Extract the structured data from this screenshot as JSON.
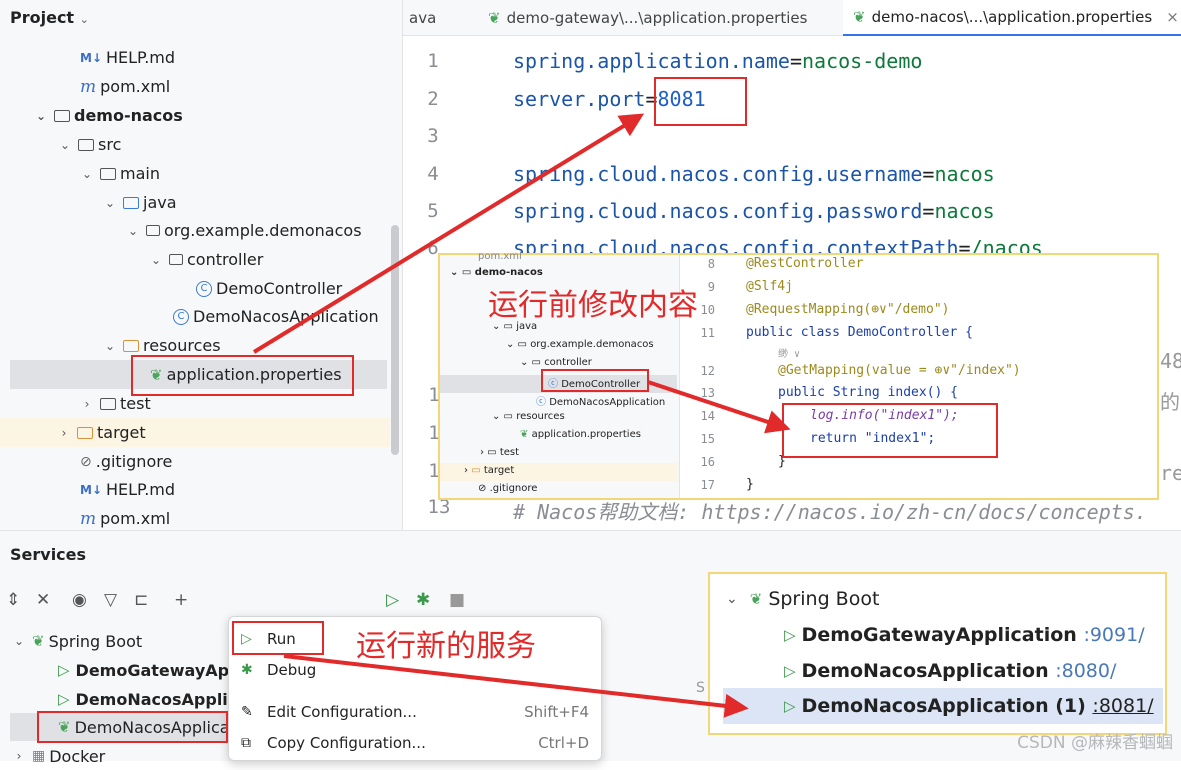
{
  "project": {
    "title": "Project",
    "tree": [
      {
        "label": "HELP.md",
        "icon": "markdown-icon"
      },
      {
        "label": "pom.xml",
        "icon": "maven-icon"
      },
      {
        "label": "demo-nacos",
        "icon": "module-folder-icon"
      },
      {
        "label": "src",
        "icon": "folder-icon"
      },
      {
        "label": "main",
        "icon": "folder-icon"
      },
      {
        "label": "java",
        "icon": "source-folder-icon"
      },
      {
        "label": "org.example.demonacos",
        "icon": "package-icon"
      },
      {
        "label": "controller",
        "icon": "package-icon"
      },
      {
        "label": "DemoController",
        "icon": "class-icon"
      },
      {
        "label": "DemoNacosApplication",
        "icon": "spring-class-icon"
      },
      {
        "label": "resources",
        "icon": "resources-folder-icon"
      },
      {
        "label": "application.properties",
        "icon": "spring-leaf-icon"
      },
      {
        "label": "test",
        "icon": "folder-icon"
      },
      {
        "label": "target",
        "icon": "excluded-folder-icon"
      },
      {
        "label": ".gitignore",
        "icon": "ignore-icon"
      },
      {
        "label": "HELP.md",
        "icon": "markdown-icon"
      },
      {
        "label": "pom.xml",
        "icon": "maven-icon"
      }
    ]
  },
  "tabs": [
    {
      "label": "ava"
    },
    {
      "label": "demo-gateway\\...\\application.properties"
    },
    {
      "label": "demo-nacos\\...\\application.properties",
      "active": true
    }
  ],
  "tab_close": "×",
  "editor": {
    "lines": [
      {
        "num": "1",
        "key": "spring.application.name",
        "eq": "=",
        "val": "nacos-demo"
      },
      {
        "num": "2",
        "key": "server.port",
        "eq": "=",
        "val": "8081"
      },
      {
        "num": "3",
        "key": "",
        "eq": "",
        "val": ""
      },
      {
        "num": "4",
        "key": "spring.cloud.nacos.config.username",
        "eq": "=",
        "val": "nacos"
      },
      {
        "num": "5",
        "key": "spring.cloud.nacos.config.password",
        "eq": "=",
        "val": "nacos"
      },
      {
        "num": "6",
        "key": "spring.cloud.nacos.config.contextPath",
        "eq": "=",
        "val": "/nacos"
      }
    ],
    "partial_right": [
      "48",
      "的",
      "res"
    ],
    "partial_nums": [
      "1",
      "1",
      "1",
      "13"
    ],
    "comment_line": "# Nacos帮助文档: https://nacos.io/zh-cn/docs/concepts."
  },
  "services": {
    "title": "Services",
    "tree": [
      {
        "label": "Spring Boot"
      },
      {
        "label": "DemoGatewayApp"
      },
      {
        "label": "DemoNacosApplic"
      },
      {
        "label": "DemoNacosApplica"
      },
      {
        "label": "Docker"
      }
    ],
    "partial": "S"
  },
  "context_menu": {
    "items": [
      {
        "label": "Run",
        "shortcut": ""
      },
      {
        "label": "Debug",
        "shortcut": ""
      },
      {
        "label": "Edit Configuration...",
        "shortcut": "Shift+F4"
      },
      {
        "label": "Copy Configuration...",
        "shortcut": "Ctrl+D"
      }
    ]
  },
  "callouts": {
    "modify": "运行前修改内容",
    "run_new": "运行新的服务"
  },
  "inset_project": {
    "items": [
      "pom.xml",
      "demo-nacos",
      "java",
      "org.example.demonacos",
      "controller",
      "DemoController",
      "DemoNacosApplication",
      "resources",
      "application.properties",
      "test",
      "target",
      ".gitignore"
    ]
  },
  "inset_code": {
    "lines": [
      {
        "num": "8",
        "text": "@RestController"
      },
      {
        "num": "9",
        "text": "@Slf4j"
      },
      {
        "num": "10",
        "text": "@RequestMapping(⊕∨\"/demo\")"
      },
      {
        "num": "11",
        "text": "public class DemoController {"
      },
      {
        "num": "",
        "text": "缈 ∨"
      },
      {
        "num": "12",
        "text": "@GetMapping(value = ⊕∨\"/index\")"
      },
      {
        "num": "13",
        "text": "public String index() {"
      },
      {
        "num": "14",
        "text": "log.info(\"index1\");"
      },
      {
        "num": "15",
        "text": "return \"index1\";"
      },
      {
        "num": "16",
        "text": "}"
      },
      {
        "num": "17",
        "text": "}"
      }
    ]
  },
  "inset_services": {
    "group": "Spring Boot",
    "apps": [
      {
        "name": "DemoGatewayApplication",
        "port": ":9091/"
      },
      {
        "name": "DemoNacosApplication",
        "port": ":8080/"
      },
      {
        "name": "DemoNacosApplication (1)",
        "port": ":8081/"
      }
    ]
  },
  "watermark": "CSDN @麻辣香蝈蝈",
  "colors": {
    "accent": "#3574f0",
    "annotation_red": "#e12a2a",
    "highlight_border": "#f3d776"
  }
}
